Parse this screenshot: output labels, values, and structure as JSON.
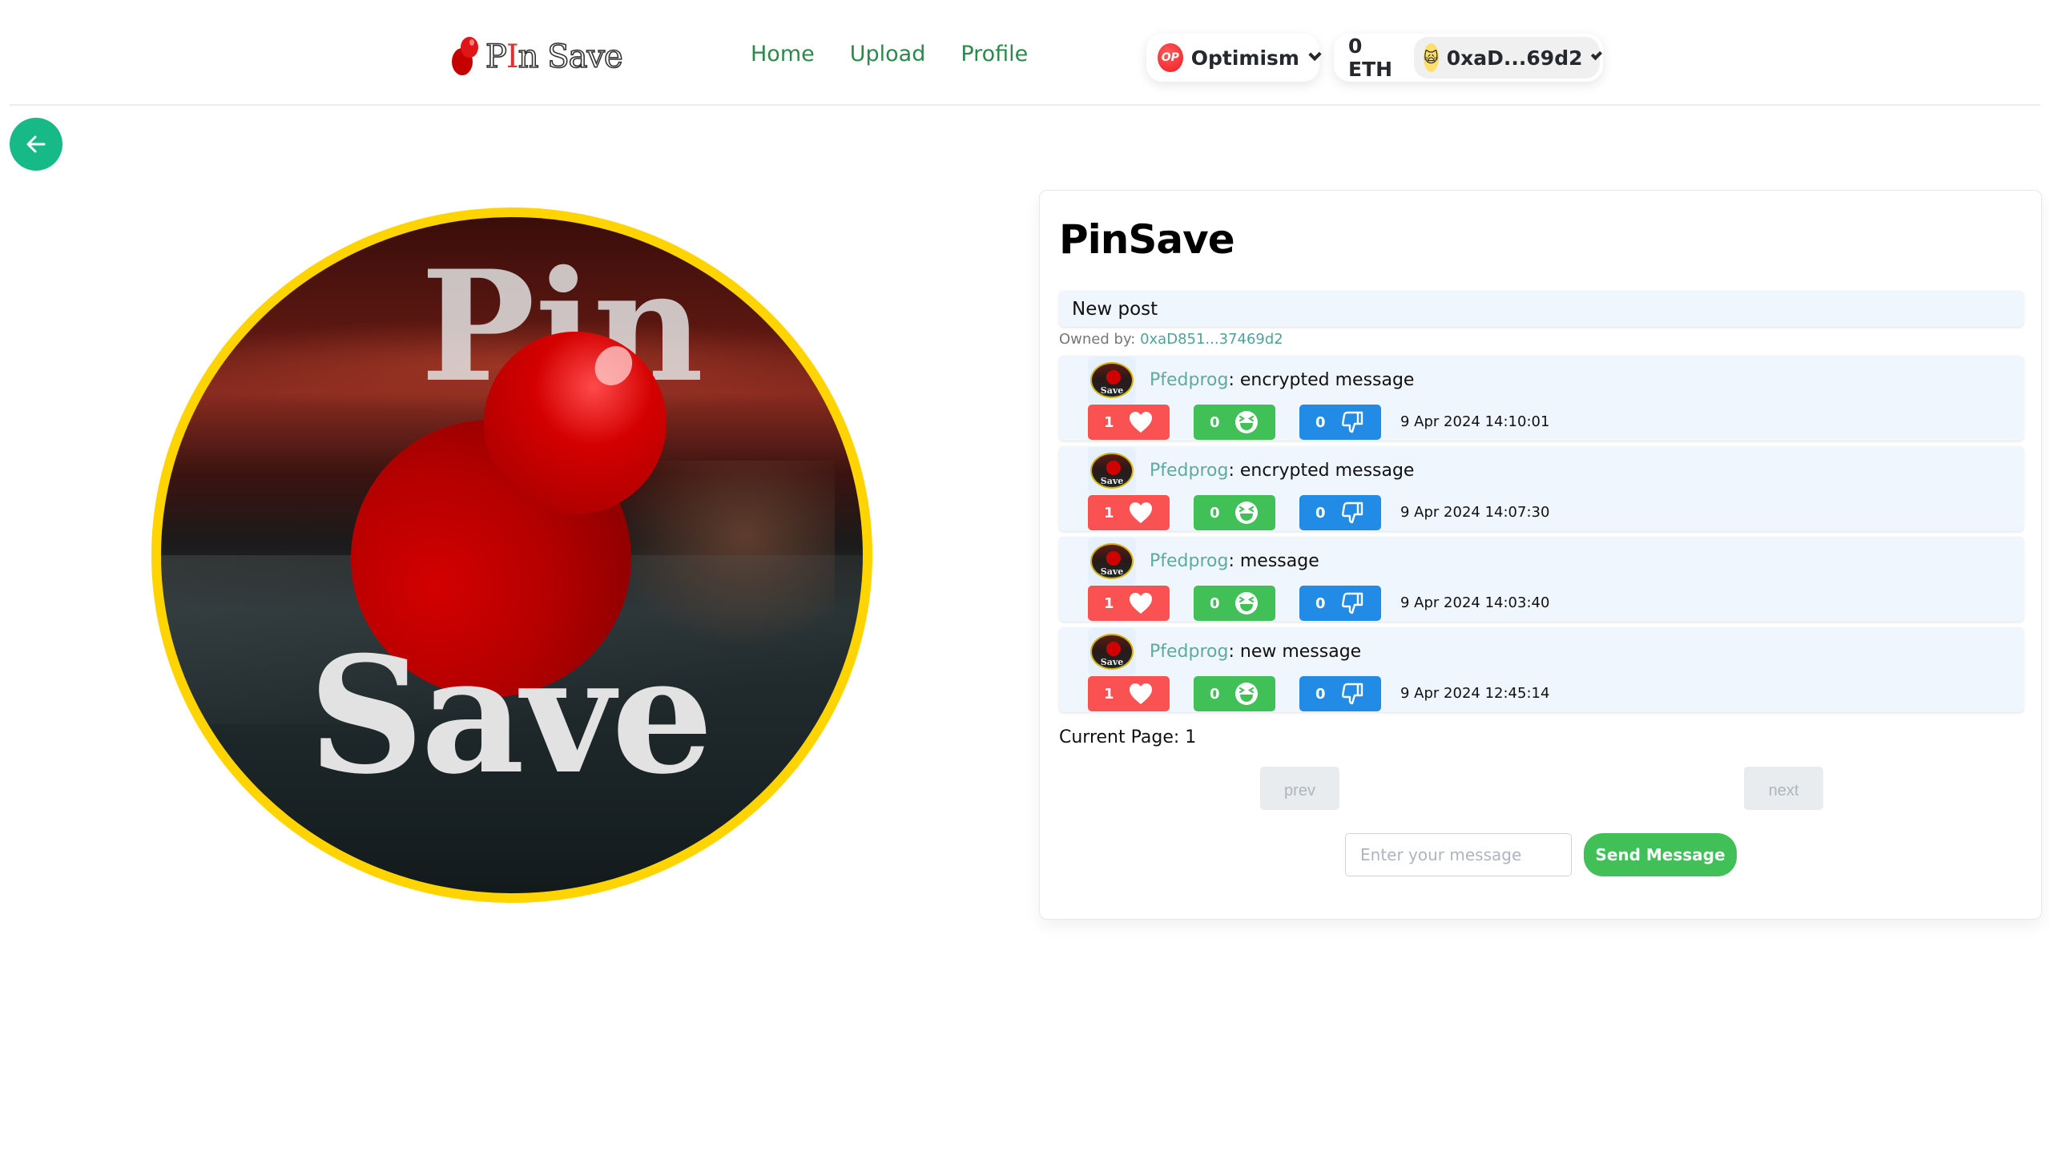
{
  "header": {
    "logo_text_pre": "P",
    "logo_text_i": "I",
    "logo_text_post": "n Save",
    "nav": [
      {
        "label": "Home"
      },
      {
        "label": "Upload"
      },
      {
        "label": "Profile"
      }
    ],
    "chain": {
      "badge": "OP",
      "name": "Optimism",
      "icon": "optimism-logo-icon"
    },
    "wallet": {
      "balance": "0 ETH",
      "address": "0xaD...69d2",
      "avatar_icon": "cat-avatar-icon",
      "avatar_glyph": "🙀"
    }
  },
  "back_button": {
    "icon": "arrow-left-icon"
  },
  "hero": {
    "top_word": "Pin",
    "bottom_word": "Save"
  },
  "post": {
    "title": "PinSave",
    "description": "New post",
    "owner_label": "Owned by: ",
    "owner_address": "0xaD851...37469d2",
    "messages": [
      {
        "author": "Pfedprog",
        "separator": ": ",
        "text": "encrypted message",
        "likes": "1",
        "laughs": "0",
        "dislikes": "0",
        "timestamp": "9 Apr 2024 14:10:01"
      },
      {
        "author": "Pfedprog",
        "separator": ": ",
        "text": "encrypted message",
        "likes": "1",
        "laughs": "0",
        "dislikes": "0",
        "timestamp": "9 Apr 2024 14:07:30"
      },
      {
        "author": "Pfedprog",
        "separator": ": ",
        "text": "message",
        "likes": "1",
        "laughs": "0",
        "dislikes": "0",
        "timestamp": "9 Apr 2024 14:03:40"
      },
      {
        "author": "Pfedprog",
        "separator": ": ",
        "text": "new message",
        "likes": "1",
        "laughs": "0",
        "dislikes": "0",
        "timestamp": "9 Apr 2024 12:45:14"
      }
    ],
    "pagination": {
      "label": "Current Page: 1",
      "prev": "prev",
      "next": "next"
    },
    "composer": {
      "placeholder": "Enter your message",
      "value": "",
      "send_label": "Send Message"
    }
  },
  "colors": {
    "accent_green": "#17b986",
    "nav_green": "#2a8a4a",
    "like_red": "#fa5252",
    "laugh_green": "#40c057",
    "dislike_blue": "#228be6",
    "author_teal": "#5ea9a0",
    "hero_ring": "#ffd400"
  }
}
